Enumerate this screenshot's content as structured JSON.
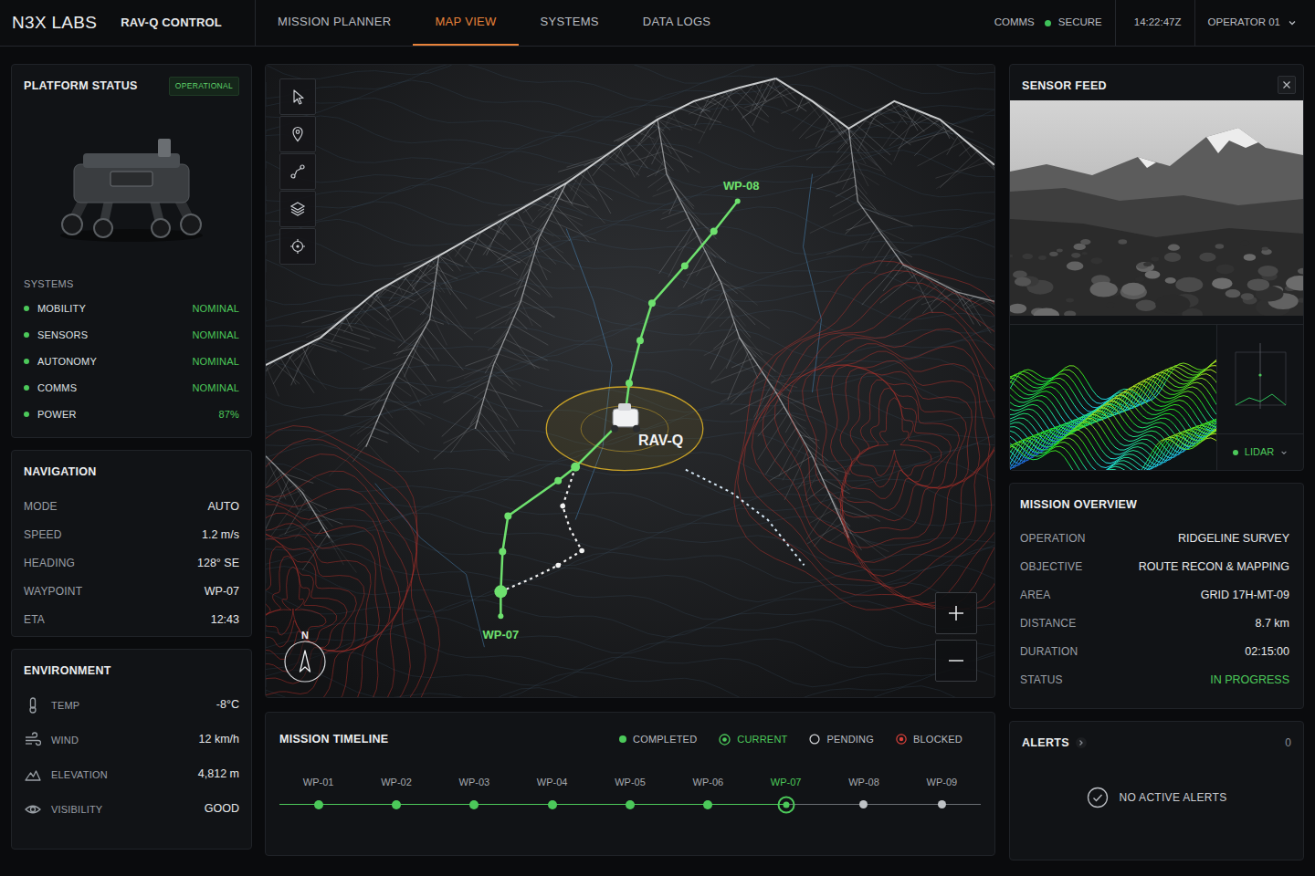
{
  "header": {
    "brand": "N3X LABS",
    "product": "RAV-Q CONTROL",
    "comms_label": "COMMS",
    "comms_state": "SECURE",
    "time": "14:22:47Z",
    "operator": "OPERATOR 01"
  },
  "nav_tabs": [
    {
      "label": "MISSION PLANNER",
      "selected": false
    },
    {
      "label": "MAP VIEW",
      "selected": true
    },
    {
      "label": "SYSTEMS",
      "selected": false
    },
    {
      "label": "DATA LOGS",
      "selected": false
    }
  ],
  "platform_status": {
    "title": "PLATFORM STATUS",
    "badge": "OPERATIONAL",
    "systems_title": "SYSTEMS",
    "systems": [
      {
        "name": "MOBILITY",
        "value": "NOMINAL"
      },
      {
        "name": "SENSORS",
        "value": "NOMINAL"
      },
      {
        "name": "AUTONOMY",
        "value": "NOMINAL"
      },
      {
        "name": "COMMS",
        "value": "NOMINAL"
      },
      {
        "name": "POWER",
        "value": "87%"
      }
    ]
  },
  "navigation": {
    "title": "NAVIGATION",
    "rows": [
      {
        "label": "MODE",
        "value": "AUTO"
      },
      {
        "label": "SPEED",
        "value": "1.2 m/s"
      },
      {
        "label": "HEADING",
        "value": "128° SE"
      },
      {
        "label": "WAYPOINT",
        "value": "WP-07"
      },
      {
        "label": "ETA",
        "value": "12:43"
      }
    ]
  },
  "environment": {
    "title": "ENVIRONMENT",
    "rows": [
      {
        "kind": "temperature",
        "label": "TEMP",
        "value": "-8°C"
      },
      {
        "kind": "wind",
        "label": "WIND",
        "value": "12 km/h"
      },
      {
        "kind": "elevation",
        "label": "ELEVATION",
        "value": "4,812 m"
      },
      {
        "kind": "visibility",
        "label": "VISIBILITY",
        "value": "GOOD"
      }
    ]
  },
  "map": {
    "vehicle_label": "RAV-Q",
    "waypoints": [
      {
        "label": "WP-08"
      },
      {
        "label": "WP-07"
      }
    ],
    "compass": "N"
  },
  "sensor_feed": {
    "title": "SENSOR FEED",
    "mode": "LIDAR"
  },
  "mission_overview": {
    "title": "MISSION OVERVIEW",
    "rows": [
      {
        "label": "OPERATION",
        "value": "RIDGELINE SURVEY",
        "color": "#e6e8ea"
      },
      {
        "label": "OBJECTIVE",
        "value": "ROUTE RECON & MAPPING",
        "color": "#e6e8ea"
      },
      {
        "label": "AREA",
        "value": "GRID 17H-MT-09",
        "color": "#e6e8ea"
      },
      {
        "label": "DISTANCE",
        "value": "8.7 km",
        "color": "#e6e8ea"
      },
      {
        "label": "DURATION",
        "value": "02:15:00",
        "color": "#e6e8ea"
      },
      {
        "label": "STATUS",
        "value": "IN PROGRESS",
        "color": "#4cc95a"
      }
    ]
  },
  "timeline": {
    "title": "MISSION TIMELINE",
    "legend": [
      {
        "label": "COMPLETED",
        "kind": "completed"
      },
      {
        "label": "CURRENT",
        "kind": "current"
      },
      {
        "label": "PENDING",
        "kind": "pending"
      },
      {
        "label": "BLOCKED",
        "kind": "blocked"
      }
    ],
    "waypoints": [
      {
        "label": "WP-01",
        "kind": "completed"
      },
      {
        "label": "WP-02",
        "kind": "completed"
      },
      {
        "label": "WP-03",
        "kind": "completed"
      },
      {
        "label": "WP-04",
        "kind": "completed"
      },
      {
        "label": "WP-05",
        "kind": "completed"
      },
      {
        "label": "WP-06",
        "kind": "completed"
      },
      {
        "label": "WP-07",
        "kind": "current"
      },
      {
        "label": "WP-08",
        "kind": "pending"
      },
      {
        "label": "WP-09",
        "kind": "pending"
      }
    ]
  },
  "alerts": {
    "title": "ALERTS",
    "count": "0",
    "message": "NO ACTIVE ALERTS"
  }
}
